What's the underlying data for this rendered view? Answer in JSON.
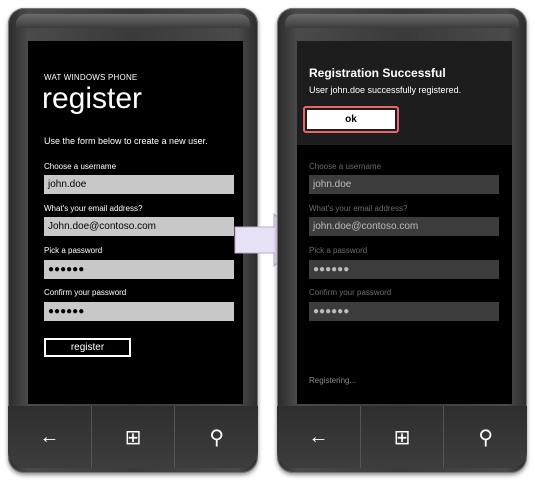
{
  "left_phone": {
    "app_title": "WAT WINDOWS PHONE",
    "page_title": "register",
    "subtitle": "Use the form below to create a new user.",
    "fields": [
      {
        "label": "Choose a username",
        "value": "john.doe"
      },
      {
        "label": "What's your email address?",
        "value": "John.doe@contoso.com"
      },
      {
        "label": "Pick a password",
        "value": "●●●●●●"
      },
      {
        "label": "Confirm your password",
        "value": "●●●●●●"
      }
    ],
    "register_label": "register"
  },
  "right_phone": {
    "dialog_title": "Registration Successful",
    "dialog_message": "User john.doe successfully registered.",
    "ok_label": "ok",
    "fields": [
      {
        "label": "Choose a username",
        "value": "john.doe"
      },
      {
        "label": "What's your email address?",
        "value": "john.doe@contoso.com"
      },
      {
        "label": "Pick a password",
        "value": "●●●●●●"
      },
      {
        "label": "Confirm your password",
        "value": "●●●●●●"
      }
    ],
    "status": "Registering..."
  },
  "hardware_buttons": {
    "back": "←",
    "start": "⊞",
    "search": "⚲"
  },
  "colors": {
    "highlight": "#e8656b",
    "arrow_fill": "#e9e2f7",
    "input_bg": "#c8c8c8"
  }
}
